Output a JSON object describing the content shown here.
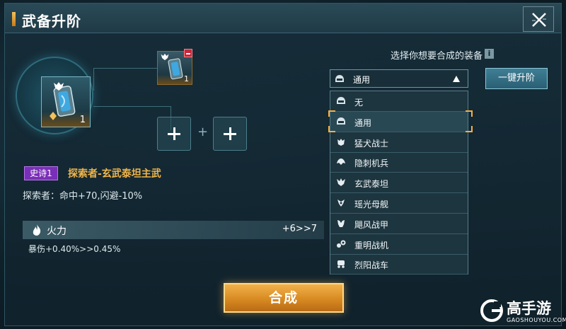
{
  "window": {
    "title": "武备升阶"
  },
  "equipment": {
    "count": "1",
    "material_count": "1",
    "rarity": "史诗1",
    "name": "探索者-玄武泰坦主武",
    "effect": "探索者：命中+70,闪避-10%"
  },
  "stat": {
    "label": "火力",
    "value": "+6>>7",
    "sub": "暴伤+0.40%>>0.45%"
  },
  "synthesize_button": "合成",
  "selector": {
    "label": "选择你想要合成的装备",
    "info": "i",
    "selected": "通用",
    "onekey_button": "一键升阶",
    "options": [
      {
        "label": "无",
        "icon": "helmet-icon"
      },
      {
        "label": "通用",
        "icon": "helmet-icon"
      },
      {
        "label": "猛犬战士",
        "icon": "dog-warrior-icon"
      },
      {
        "label": "隐刺机兵",
        "icon": "stealth-mech-icon"
      },
      {
        "label": "玄武泰坦",
        "icon": "titan-icon"
      },
      {
        "label": "瑶光母舰",
        "icon": "mothership-icon"
      },
      {
        "label": "飓风战甲",
        "icon": "armor-icon"
      },
      {
        "label": "重明战机",
        "icon": "fighter-icon"
      },
      {
        "label": "烈阳战车",
        "icon": "chariot-icon"
      }
    ],
    "selected_index": 1
  },
  "watermark": {
    "brand": "高手游",
    "url": "GAOSHOUYOU.COM"
  },
  "colors": {
    "accent_gold": "#f0b54a",
    "epic_purple": "#7a2fb8",
    "panel_bg": "#1f3a46",
    "button_teal": "#2a5f74"
  }
}
